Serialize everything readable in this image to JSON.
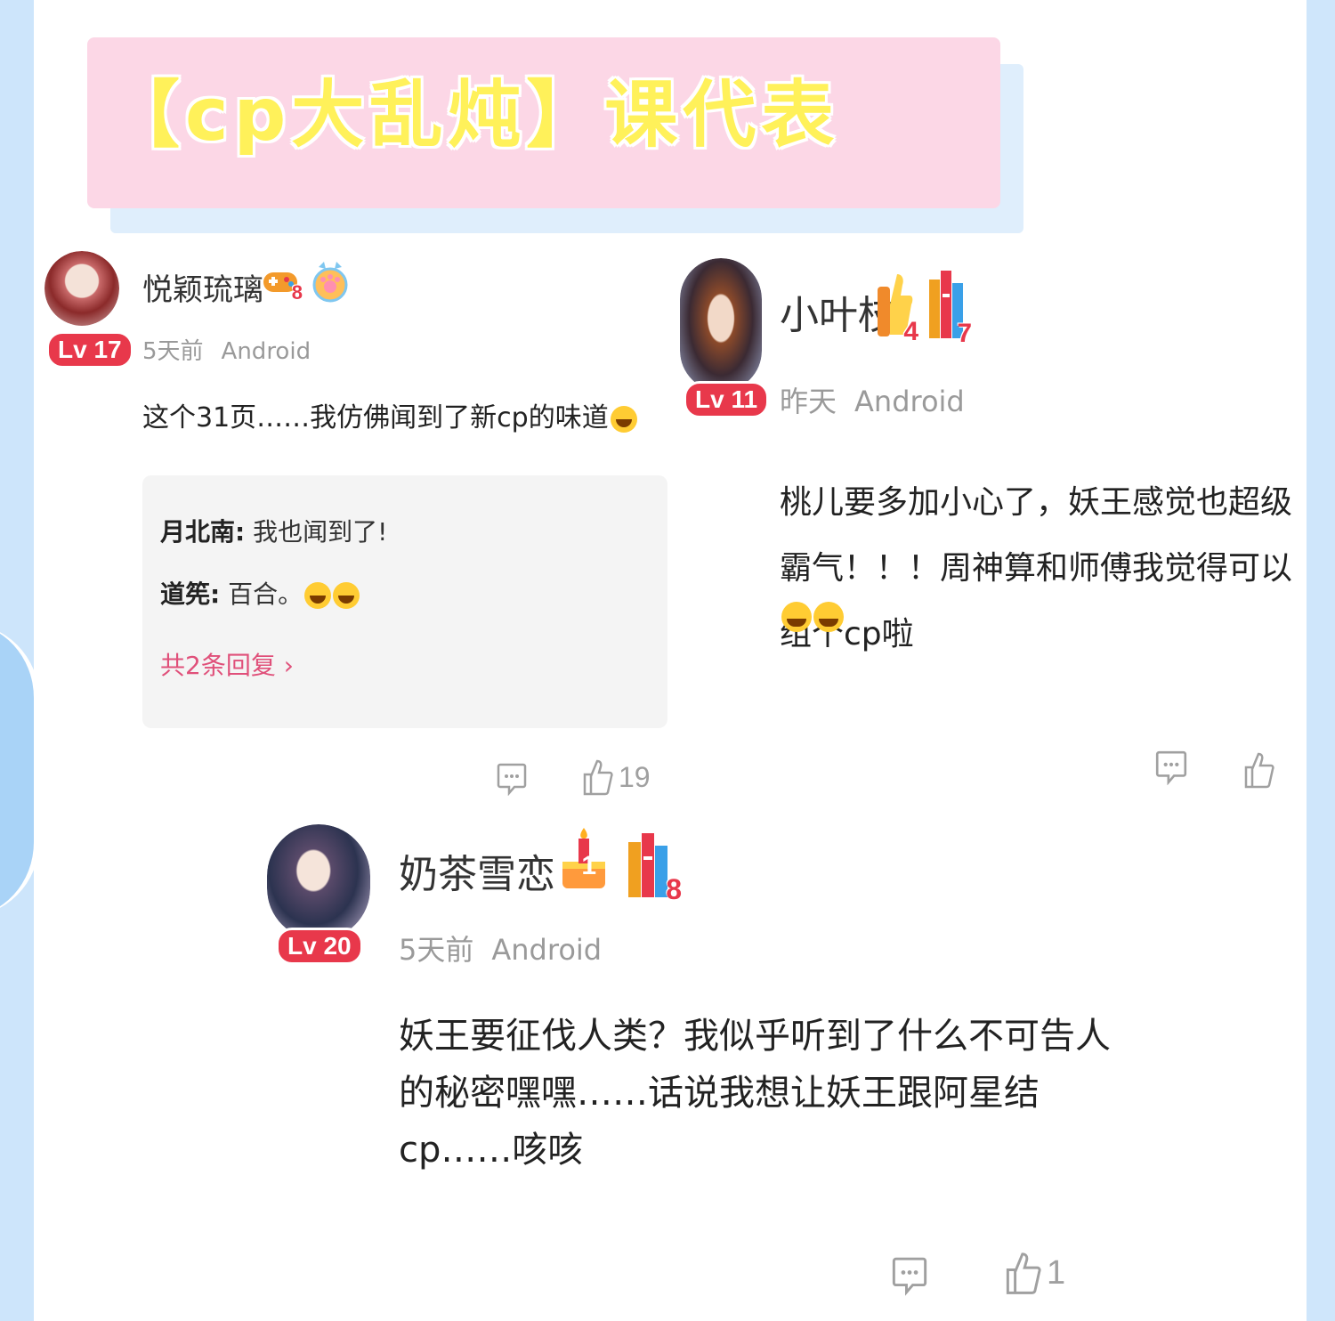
{
  "banner": {
    "title": "【cp大乱炖】课代表"
  },
  "comments": [
    {
      "username": "悦颖琉璃",
      "level": "Lv 17",
      "time": "5天前",
      "device": "Android",
      "text": "这个31页……我仿佛闻到了新cp的味道",
      "medals": [
        {
          "icon": "game-controller-medal-icon",
          "count": "8"
        },
        {
          "icon": "paw-badge-icon",
          "count": ""
        }
      ],
      "replies": [
        {
          "author": "月北南:",
          "text": " 我也闻到了!"
        },
        {
          "author": "道筅:",
          "text": " 百合。"
        }
      ],
      "more_replies": "共2条回复",
      "like_count": "19"
    },
    {
      "username": "小叶枝",
      "level": "Lv 11",
      "time": "昨天",
      "device": "Android",
      "text": "桃儿要多加小心了，妖王感觉也超级霸气！！！周神算和师傅我觉得可以组个cp啦",
      "medals": [
        {
          "icon": "thumbs-up-medal-icon",
          "count": "4"
        },
        {
          "icon": "books-medal-icon",
          "count": "7"
        }
      ],
      "like_count": ""
    },
    {
      "username": "奶茶雪恋",
      "level": "Lv 20",
      "time": "5天前",
      "device": "Android",
      "text": "妖王要征伐人类？我似乎听到了什么不可告人的秘密嘿嘿……话说我想让妖王跟阿星结cp……咳咳",
      "medals": [
        {
          "icon": "birthday-cake-medal-icon",
          "count": "1"
        },
        {
          "icon": "books-medal-icon",
          "count": "8"
        }
      ],
      "like_count": "1"
    }
  ],
  "colors": {
    "level_badge": "#e8384b",
    "reply_link": "#e0507a",
    "banner_bg": "#fcd7e6",
    "banner_text": "#fff15a"
  }
}
